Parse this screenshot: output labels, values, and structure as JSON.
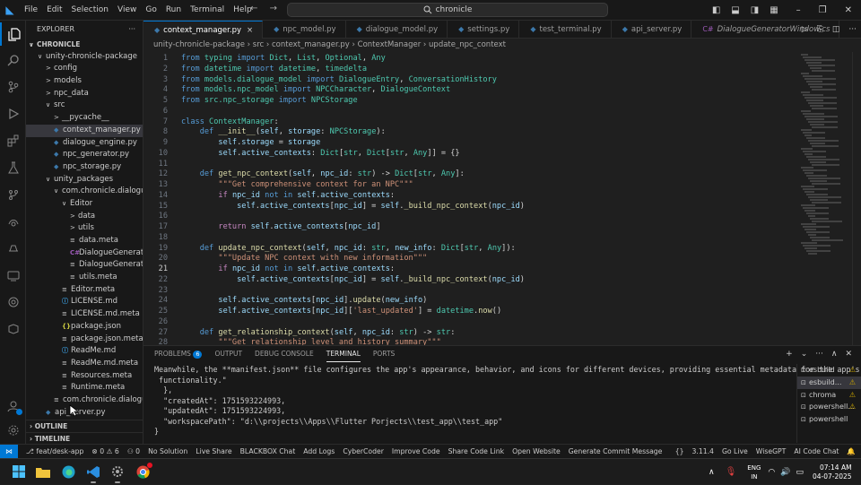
{
  "titlebar": {
    "menu": [
      "File",
      "Edit",
      "Selection",
      "View",
      "Go",
      "Run",
      "Terminal",
      "Help"
    ],
    "search": "chronicle",
    "nav_back": "←",
    "nav_fwd": "→"
  },
  "activity_icons": [
    "files-icon",
    "search-icon",
    "source-control-icon",
    "run-debug-icon",
    "extensions-icon",
    "testing-icon",
    "flask-icon",
    "git-graph-icon",
    "remote-icon",
    "docker-icon",
    "chat-icon",
    "blackbox-icon"
  ],
  "sidebar": {
    "title": "EXPLORER",
    "tree": [
      {
        "label": "CHRONICLE",
        "depth": 0,
        "type": "root",
        "chev": "∨"
      },
      {
        "label": "unity-chronicle-package",
        "depth": 1,
        "type": "folder",
        "chev": "∨"
      },
      {
        "label": "config",
        "depth": 2,
        "type": "folder",
        "chev": ">"
      },
      {
        "label": "models",
        "depth": 2,
        "type": "folder",
        "chev": ">"
      },
      {
        "label": "npc_data",
        "depth": 2,
        "type": "folder",
        "chev": ">"
      },
      {
        "label": "src",
        "depth": 2,
        "type": "folder",
        "chev": "∨"
      },
      {
        "label": "__pycache__",
        "depth": 3,
        "type": "folder",
        "chev": ">"
      },
      {
        "label": "context_manager.py",
        "depth": 3,
        "type": "py",
        "selected": true
      },
      {
        "label": "dialogue_engine.py",
        "depth": 3,
        "type": "py"
      },
      {
        "label": "npc_generator.py",
        "depth": 3,
        "type": "py"
      },
      {
        "label": "npc_storage.py",
        "depth": 3,
        "type": "py"
      },
      {
        "label": "unity_packages",
        "depth": 2,
        "type": "folder",
        "chev": "∨"
      },
      {
        "label": "com.chronicle.dialogueG...",
        "depth": 3,
        "type": "folder",
        "chev": "∨"
      },
      {
        "label": "Editor",
        "depth": 4,
        "type": "folder",
        "chev": "∨"
      },
      {
        "label": "data",
        "depth": 5,
        "type": "folder",
        "chev": ">"
      },
      {
        "label": "utils",
        "depth": 5,
        "type": "folder",
        "chev": ">"
      },
      {
        "label": "data.meta",
        "depth": 5,
        "type": "meta"
      },
      {
        "label": "DialogueGeneratorWi...",
        "depth": 5,
        "type": "cs"
      },
      {
        "label": "DialogueGeneratorWi...",
        "depth": 5,
        "type": "meta"
      },
      {
        "label": "utils.meta",
        "depth": 5,
        "type": "meta"
      },
      {
        "label": "Editor.meta",
        "depth": 4,
        "type": "meta"
      },
      {
        "label": "LICENSE.md",
        "depth": 4,
        "type": "md"
      },
      {
        "label": "LICENSE.md.meta",
        "depth": 4,
        "type": "meta"
      },
      {
        "label": "package.json",
        "depth": 4,
        "type": "json"
      },
      {
        "label": "package.json.meta",
        "depth": 4,
        "type": "meta"
      },
      {
        "label": "ReadMe.md",
        "depth": 4,
        "type": "md"
      },
      {
        "label": "ReadMe.md.meta",
        "depth": 4,
        "type": "meta"
      },
      {
        "label": "Resources.meta",
        "depth": 4,
        "type": "meta"
      },
      {
        "label": "Runtime.meta",
        "depth": 4,
        "type": "meta"
      },
      {
        "label": "com.chronicle.dialogueG...",
        "depth": 3,
        "type": "meta"
      },
      {
        "label": "api_server.py",
        "depth": 2,
        "type": "py"
      }
    ],
    "outline": "OUTLINE",
    "timeline": "TIMELINE"
  },
  "tabs": [
    {
      "label": "context_manager.py",
      "icon": "py",
      "active": true,
      "close": "×"
    },
    {
      "label": "npc_model.py",
      "icon": "py"
    },
    {
      "label": "dialogue_model.py",
      "icon": "py"
    },
    {
      "label": "settings.py",
      "icon": "py"
    },
    {
      "label": "test_terminal.py",
      "icon": "py"
    },
    {
      "label": "api_server.py",
      "icon": "py"
    },
    {
      "label": "DialogueGeneratorWindow.cs",
      "icon": "cs"
    }
  ],
  "breadcrumb": [
    "unity-chronicle-package",
    "src",
    "context_manager.py",
    "ContextManager",
    "update_npc_context"
  ],
  "editor": {
    "current_line": 21,
    "lines": [
      {
        "n": 1,
        "t": [
          [
            "k",
            "from "
          ],
          [
            "c",
            "typing"
          ],
          [
            "k",
            " import "
          ],
          [
            "c",
            "Dict"
          ],
          [
            "p",
            ", "
          ],
          [
            "c",
            "List"
          ],
          [
            "p",
            ", "
          ],
          [
            "c",
            "Optional"
          ],
          [
            "p",
            ", "
          ],
          [
            "c",
            "Any"
          ]
        ]
      },
      {
        "n": 2,
        "t": [
          [
            "k",
            "from "
          ],
          [
            "c",
            "datetime"
          ],
          [
            "k",
            " import "
          ],
          [
            "c",
            "datetime"
          ],
          [
            "p",
            ", "
          ],
          [
            "c",
            "timedelta"
          ]
        ]
      },
      {
        "n": 3,
        "t": [
          [
            "k",
            "from "
          ],
          [
            "c",
            "models.dialogue_model"
          ],
          [
            "k",
            " import "
          ],
          [
            "c",
            "DialogueEntry"
          ],
          [
            "p",
            ", "
          ],
          [
            "c",
            "ConversationHistory"
          ]
        ]
      },
      {
        "n": 4,
        "t": [
          [
            "k",
            "from "
          ],
          [
            "c",
            "models.npc_model"
          ],
          [
            "k",
            " import "
          ],
          [
            "c",
            "NPCCharacter"
          ],
          [
            "p",
            ", "
          ],
          [
            "c",
            "DialogueContext"
          ]
        ]
      },
      {
        "n": 5,
        "t": [
          [
            "k",
            "from "
          ],
          [
            "c",
            "src.npc_storage"
          ],
          [
            "k",
            " import "
          ],
          [
            "c",
            "NPCStorage"
          ]
        ]
      },
      {
        "n": 6,
        "t": []
      },
      {
        "n": 7,
        "t": [
          [
            "k",
            "class "
          ],
          [
            "c",
            "ContextManager"
          ],
          [
            "p",
            ":"
          ]
        ]
      },
      {
        "n": 8,
        "t": [
          [
            "p",
            "    "
          ],
          [
            "k",
            "def "
          ],
          [
            "f",
            "__init__"
          ],
          [
            "p",
            "("
          ],
          [
            "v",
            "self"
          ],
          [
            "p",
            ", "
          ],
          [
            "v",
            "storage"
          ],
          [
            "p",
            ": "
          ],
          [
            "c",
            "NPCStorage"
          ],
          [
            "p",
            "):"
          ]
        ]
      },
      {
        "n": 9,
        "t": [
          [
            "p",
            "        "
          ],
          [
            "v",
            "self"
          ],
          [
            "p",
            "."
          ],
          [
            "v",
            "storage"
          ],
          [
            "p",
            " = "
          ],
          [
            "v",
            "storage"
          ]
        ]
      },
      {
        "n": 10,
        "t": [
          [
            "p",
            "        "
          ],
          [
            "v",
            "self"
          ],
          [
            "p",
            "."
          ],
          [
            "v",
            "active_contexts"
          ],
          [
            "p",
            ": "
          ],
          [
            "c",
            "Dict"
          ],
          [
            "p",
            "["
          ],
          [
            "c",
            "str"
          ],
          [
            "p",
            ", "
          ],
          [
            "c",
            "Dict"
          ],
          [
            "p",
            "["
          ],
          [
            "c",
            "str"
          ],
          [
            "p",
            ", "
          ],
          [
            "c",
            "Any"
          ],
          [
            "p",
            "]] = {}"
          ]
        ]
      },
      {
        "n": 11,
        "t": []
      },
      {
        "n": 12,
        "t": [
          [
            "p",
            "    "
          ],
          [
            "k",
            "def "
          ],
          [
            "f",
            "get_npc_context"
          ],
          [
            "p",
            "("
          ],
          [
            "v",
            "self"
          ],
          [
            "p",
            ", "
          ],
          [
            "v",
            "npc_id"
          ],
          [
            "p",
            ": "
          ],
          [
            "c",
            "str"
          ],
          [
            "p",
            ") -> "
          ],
          [
            "c",
            "Dict"
          ],
          [
            "p",
            "["
          ],
          [
            "c",
            "str"
          ],
          [
            "p",
            ", "
          ],
          [
            "c",
            "Any"
          ],
          [
            "p",
            "]:"
          ]
        ]
      },
      {
        "n": 13,
        "t": [
          [
            "p",
            "        "
          ],
          [
            "s",
            "\"\"\"Get comprehensive context for an NPC\"\"\""
          ]
        ]
      },
      {
        "n": 14,
        "t": [
          [
            "p",
            "        "
          ],
          [
            "kc",
            "if "
          ],
          [
            "v",
            "npc_id"
          ],
          [
            "k",
            " not in "
          ],
          [
            "v",
            "self"
          ],
          [
            "p",
            "."
          ],
          [
            "v",
            "active_contexts"
          ],
          [
            "p",
            ":"
          ]
        ]
      },
      {
        "n": 15,
        "t": [
          [
            "p",
            "            "
          ],
          [
            "v",
            "self"
          ],
          [
            "p",
            "."
          ],
          [
            "v",
            "active_contexts"
          ],
          [
            "p",
            "["
          ],
          [
            "v",
            "npc_id"
          ],
          [
            "p",
            "] = "
          ],
          [
            "v",
            "self"
          ],
          [
            "p",
            "."
          ],
          [
            "f",
            "_build_npc_context"
          ],
          [
            "p",
            "("
          ],
          [
            "v",
            "npc_id"
          ],
          [
            "p",
            ")"
          ]
        ]
      },
      {
        "n": 16,
        "t": []
      },
      {
        "n": 17,
        "t": [
          [
            "p",
            "        "
          ],
          [
            "kc",
            "return "
          ],
          [
            "v",
            "self"
          ],
          [
            "p",
            "."
          ],
          [
            "v",
            "active_contexts"
          ],
          [
            "p",
            "["
          ],
          [
            "v",
            "npc_id"
          ],
          [
            "p",
            "]"
          ]
        ]
      },
      {
        "n": 18,
        "t": []
      },
      {
        "n": 19,
        "t": [
          [
            "p",
            "    "
          ],
          [
            "k",
            "def "
          ],
          [
            "f",
            "update_npc_context"
          ],
          [
            "p",
            "("
          ],
          [
            "v",
            "self"
          ],
          [
            "p",
            ", "
          ],
          [
            "v",
            "npc_id"
          ],
          [
            "p",
            ": "
          ],
          [
            "c",
            "str"
          ],
          [
            "p",
            ", "
          ],
          [
            "v",
            "new_info"
          ],
          [
            "p",
            ": "
          ],
          [
            "c",
            "Dict"
          ],
          [
            "p",
            "["
          ],
          [
            "c",
            "str"
          ],
          [
            "p",
            ", "
          ],
          [
            "c",
            "Any"
          ],
          [
            "p",
            "]):"
          ]
        ]
      },
      {
        "n": 20,
        "t": [
          [
            "p",
            "        "
          ],
          [
            "s",
            "\"\"\"Update NPC context with new information\"\"\""
          ]
        ]
      },
      {
        "n": 21,
        "t": [
          [
            "p",
            "        "
          ],
          [
            "kc",
            "if "
          ],
          [
            "v",
            "npc_id"
          ],
          [
            "k",
            " not in "
          ],
          [
            "v",
            "self"
          ],
          [
            "p",
            "."
          ],
          [
            "v",
            "active_contexts"
          ],
          [
            "p",
            ":"
          ]
        ]
      },
      {
        "n": 22,
        "t": [
          [
            "p",
            "            "
          ],
          [
            "v",
            "self"
          ],
          [
            "p",
            "."
          ],
          [
            "v",
            "active_contexts"
          ],
          [
            "p",
            "["
          ],
          [
            "v",
            "npc_id"
          ],
          [
            "p",
            "] = "
          ],
          [
            "v",
            "self"
          ],
          [
            "p",
            "."
          ],
          [
            "f",
            "_build_npc_context"
          ],
          [
            "p",
            "("
          ],
          [
            "v",
            "npc_id"
          ],
          [
            "p",
            ")"
          ]
        ]
      },
      {
        "n": 23,
        "t": []
      },
      {
        "n": 24,
        "t": [
          [
            "p",
            "        "
          ],
          [
            "v",
            "self"
          ],
          [
            "p",
            "."
          ],
          [
            "v",
            "active_contexts"
          ],
          [
            "p",
            "["
          ],
          [
            "v",
            "npc_id"
          ],
          [
            "p",
            "]."
          ],
          [
            "f",
            "update"
          ],
          [
            "p",
            "("
          ],
          [
            "v",
            "new_info"
          ],
          [
            "p",
            ")"
          ]
        ]
      },
      {
        "n": 25,
        "t": [
          [
            "p",
            "        "
          ],
          [
            "v",
            "self"
          ],
          [
            "p",
            "."
          ],
          [
            "v",
            "active_contexts"
          ],
          [
            "p",
            "["
          ],
          [
            "v",
            "npc_id"
          ],
          [
            "p",
            "]["
          ],
          [
            "s",
            "'last_updated'"
          ],
          [
            "p",
            "] = "
          ],
          [
            "c",
            "datetime"
          ],
          [
            "p",
            "."
          ],
          [
            "f",
            "now"
          ],
          [
            "p",
            "()"
          ]
        ]
      },
      {
        "n": 26,
        "t": []
      },
      {
        "n": 27,
        "t": [
          [
            "p",
            "    "
          ],
          [
            "k",
            "def "
          ],
          [
            "f",
            "get_relationship_context"
          ],
          [
            "p",
            "("
          ],
          [
            "v",
            "self"
          ],
          [
            "p",
            ", "
          ],
          [
            "v",
            "npc_id"
          ],
          [
            "p",
            ": "
          ],
          [
            "c",
            "str"
          ],
          [
            "p",
            ") -> "
          ],
          [
            "c",
            "str"
          ],
          [
            "p",
            ":"
          ]
        ]
      },
      {
        "n": 28,
        "t": [
          [
            "p",
            "        "
          ],
          [
            "s",
            "\"\"\"Get relationship level and history summary\"\"\""
          ]
        ]
      }
    ]
  },
  "panel": {
    "tabs": [
      {
        "label": "PROBLEMS",
        "badge": "6"
      },
      {
        "label": "OUTPUT"
      },
      {
        "label": "DEBUG CONSOLE"
      },
      {
        "label": "TERMINAL",
        "active": true
      },
      {
        "label": "PORTS"
      }
    ],
    "terminal_lines": [
      "Meanwhile, the **manifest.json** file configures the app's appearance, behavior, and icons for different devices, providing essential metadata for the app's",
      " functionality.\"",
      "  },",
      "  \"createdAt\": 1751593224993,",
      "  \"updatedAt\": 1751593224993,",
      "  \"workspacePath\": \"d:\\\\projects\\\\Apps\\\\Flutter Porjects\\\\test_app\\\\test_app\"",
      "}",
      ""
    ],
    "terminals": [
      {
        "label": "esbuild",
        "warn": true
      },
      {
        "label": "esbuild...",
        "warn": true,
        "selected": true
      },
      {
        "label": "chroma",
        "warn": true
      },
      {
        "label": "powershell...",
        "warn": true
      },
      {
        "label": "powershell"
      }
    ]
  },
  "statusbar": {
    "branch": "feat/desk-app",
    "problems": "⊗ 0 ⚠ 6",
    "items": [
      "⚇ 0",
      "No Solution",
      "Live Share",
      "BLACKBOX Chat",
      "Add Logs",
      "CyberCoder",
      "Improve Code",
      "Share Code Link",
      "Open Website",
      "Generate Commit Message"
    ],
    "right": [
      "{} ",
      "3.11.4",
      "Go Live",
      "WiseGPT",
      "AI Code Chat"
    ]
  },
  "taskbar": {
    "lang": "ENG",
    "region": "IN",
    "time": "07:14 AM",
    "date": "04-07-2025"
  }
}
